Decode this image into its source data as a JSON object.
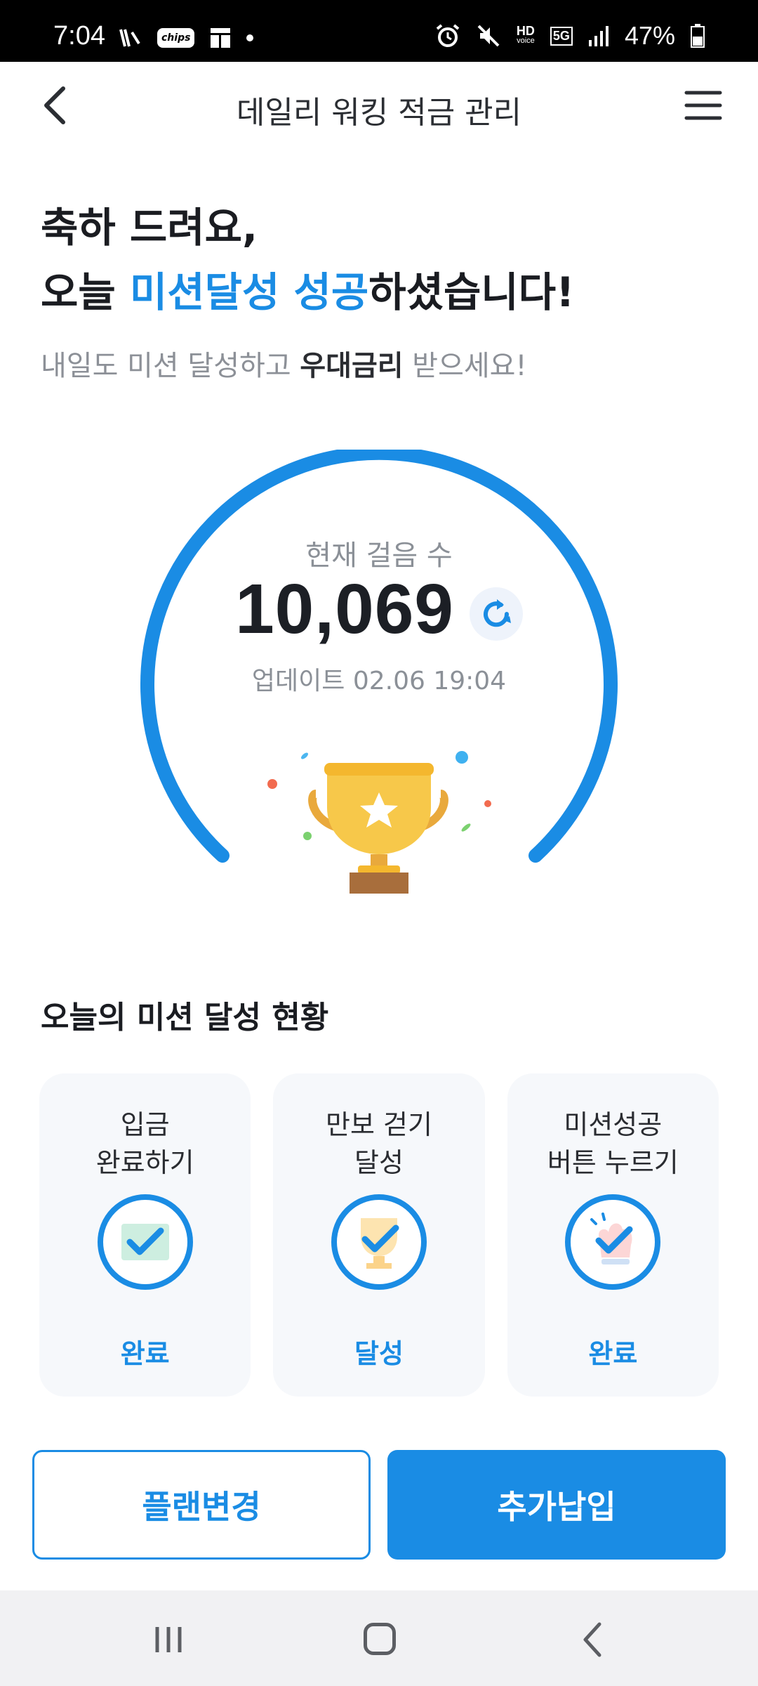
{
  "status_bar": {
    "time": "7:04",
    "chips_label": "chips",
    "battery": "47%",
    "net_hd": "HD",
    "net_voice": "voice",
    "net_5g": "5G",
    "left_icons": [
      "nfc-icon",
      "chips-icon",
      "grid-icon",
      "dot-icon"
    ],
    "right_icons": [
      "alarm-icon",
      "mute-icon",
      "hd-voice-icon",
      "5g-icon",
      "signal-icon",
      "battery-icon"
    ]
  },
  "header": {
    "title": "데일리 워킹 적금 관리",
    "back_icon": "back-arrow-icon",
    "menu_icon": "hamburger-menu-icon"
  },
  "headline": {
    "line1": "축하 드려요,",
    "line2_prefix": "오늘 ",
    "line2_highlight": "미션달성 성공",
    "line2_suffix": "하셨습니다!",
    "sub_prefix": "내일도 미션 달성하고 ",
    "sub_bold": "우대금리",
    "sub_suffix": " 받으세요!"
  },
  "gauge": {
    "label": "현재 걸음 수",
    "steps": "10,069",
    "update_text": "업데이트 02.06 19:04",
    "refresh_icon": "refresh-icon",
    "trophy_icon": "trophy-icon",
    "accent_color": "#1a8ce4"
  },
  "missions": {
    "title": "오늘의 미션 달성 현황",
    "items": [
      {
        "title": "입금\n완료하기",
        "status": "완료",
        "icon": "deposit-check-icon"
      },
      {
        "title": "만보 걷기\n달성",
        "status": "달성",
        "icon": "trophy-check-icon"
      },
      {
        "title": "미션성공\n버튼 누르기",
        "status": "완료",
        "icon": "tap-check-icon"
      }
    ]
  },
  "buttons": {
    "plan_change": "플랜변경",
    "add_payment": "추가납입"
  },
  "navbar": {
    "recents_icon": "recents-icon",
    "home_icon": "home-icon",
    "back_icon": "nav-back-icon"
  }
}
